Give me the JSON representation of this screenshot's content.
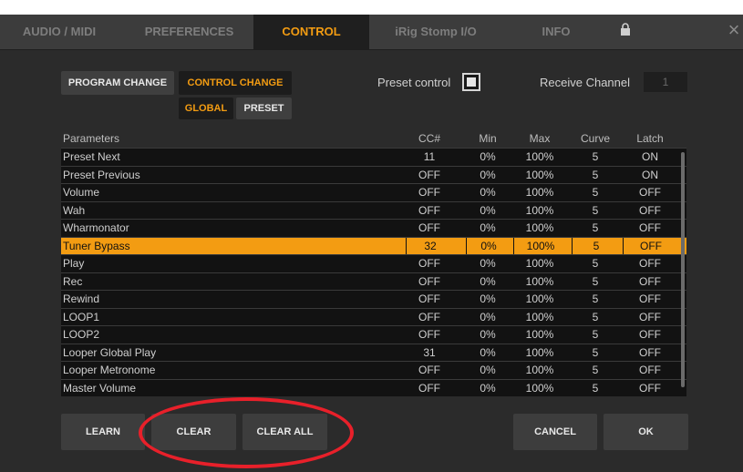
{
  "tabs": [
    {
      "label": "AUDIO / MIDI"
    },
    {
      "label": "PREFERENCES"
    },
    {
      "label": "CONTROL"
    },
    {
      "label": "iRig Stomp I/O"
    },
    {
      "label": "INFO"
    }
  ],
  "active_tab": "CONTROL",
  "close_glyph": "×",
  "mode_buttons": {
    "program_change": "PROGRAM CHANGE",
    "control_change": "CONTROL CHANGE",
    "global": "GLOBAL",
    "preset": "PRESET"
  },
  "preset_control": {
    "label": "Preset control",
    "checked": true
  },
  "receive_channel": {
    "label": "Receive Channel",
    "value": "1"
  },
  "table": {
    "headers": {
      "parameters": "Parameters",
      "cc": "CC#",
      "min": "Min",
      "max": "Max",
      "curve": "Curve",
      "latch": "Latch"
    },
    "rows": [
      {
        "name": "Preset Next",
        "cc": "11",
        "min": "0%",
        "max": "100%",
        "curve": "5",
        "latch": "ON"
      },
      {
        "name": "Preset Previous",
        "cc": "OFF",
        "min": "0%",
        "max": "100%",
        "curve": "5",
        "latch": "ON"
      },
      {
        "name": "Volume",
        "cc": "OFF",
        "min": "0%",
        "max": "100%",
        "curve": "5",
        "latch": "OFF"
      },
      {
        "name": "Wah",
        "cc": "OFF",
        "min": "0%",
        "max": "100%",
        "curve": "5",
        "latch": "OFF"
      },
      {
        "name": "Wharmonator",
        "cc": "OFF",
        "min": "0%",
        "max": "100%",
        "curve": "5",
        "latch": "OFF"
      },
      {
        "name": "Tuner Bypass",
        "cc": "32",
        "min": "0%",
        "max": "100%",
        "curve": "5",
        "latch": "OFF",
        "selected": true
      },
      {
        "name": "Play",
        "cc": "OFF",
        "min": "0%",
        "max": "100%",
        "curve": "5",
        "latch": "OFF"
      },
      {
        "name": "Rec",
        "cc": "OFF",
        "min": "0%",
        "max": "100%",
        "curve": "5",
        "latch": "OFF"
      },
      {
        "name": "Rewind",
        "cc": "OFF",
        "min": "0%",
        "max": "100%",
        "curve": "5",
        "latch": "OFF"
      },
      {
        "name": "LOOP1",
        "cc": "OFF",
        "min": "0%",
        "max": "100%",
        "curve": "5",
        "latch": "OFF"
      },
      {
        "name": "LOOP2",
        "cc": "OFF",
        "min": "0%",
        "max": "100%",
        "curve": "5",
        "latch": "OFF"
      },
      {
        "name": "Looper Global Play",
        "cc": "31",
        "min": "0%",
        "max": "100%",
        "curve": "5",
        "latch": "OFF"
      },
      {
        "name": "Looper Metronome",
        "cc": "OFF",
        "min": "0%",
        "max": "100%",
        "curve": "5",
        "latch": "OFF"
      },
      {
        "name": "Master Volume",
        "cc": "OFF",
        "min": "0%",
        "max": "100%",
        "curve": "5",
        "latch": "OFF"
      }
    ]
  },
  "bottom_buttons": {
    "learn": "LEARN",
    "clear": "CLEAR",
    "clear_all": "CLEAR ALL",
    "cancel": "CANCEL",
    "ok": "OK"
  },
  "colors": {
    "accent": "#f39c12",
    "annotation": "#e8202a"
  }
}
